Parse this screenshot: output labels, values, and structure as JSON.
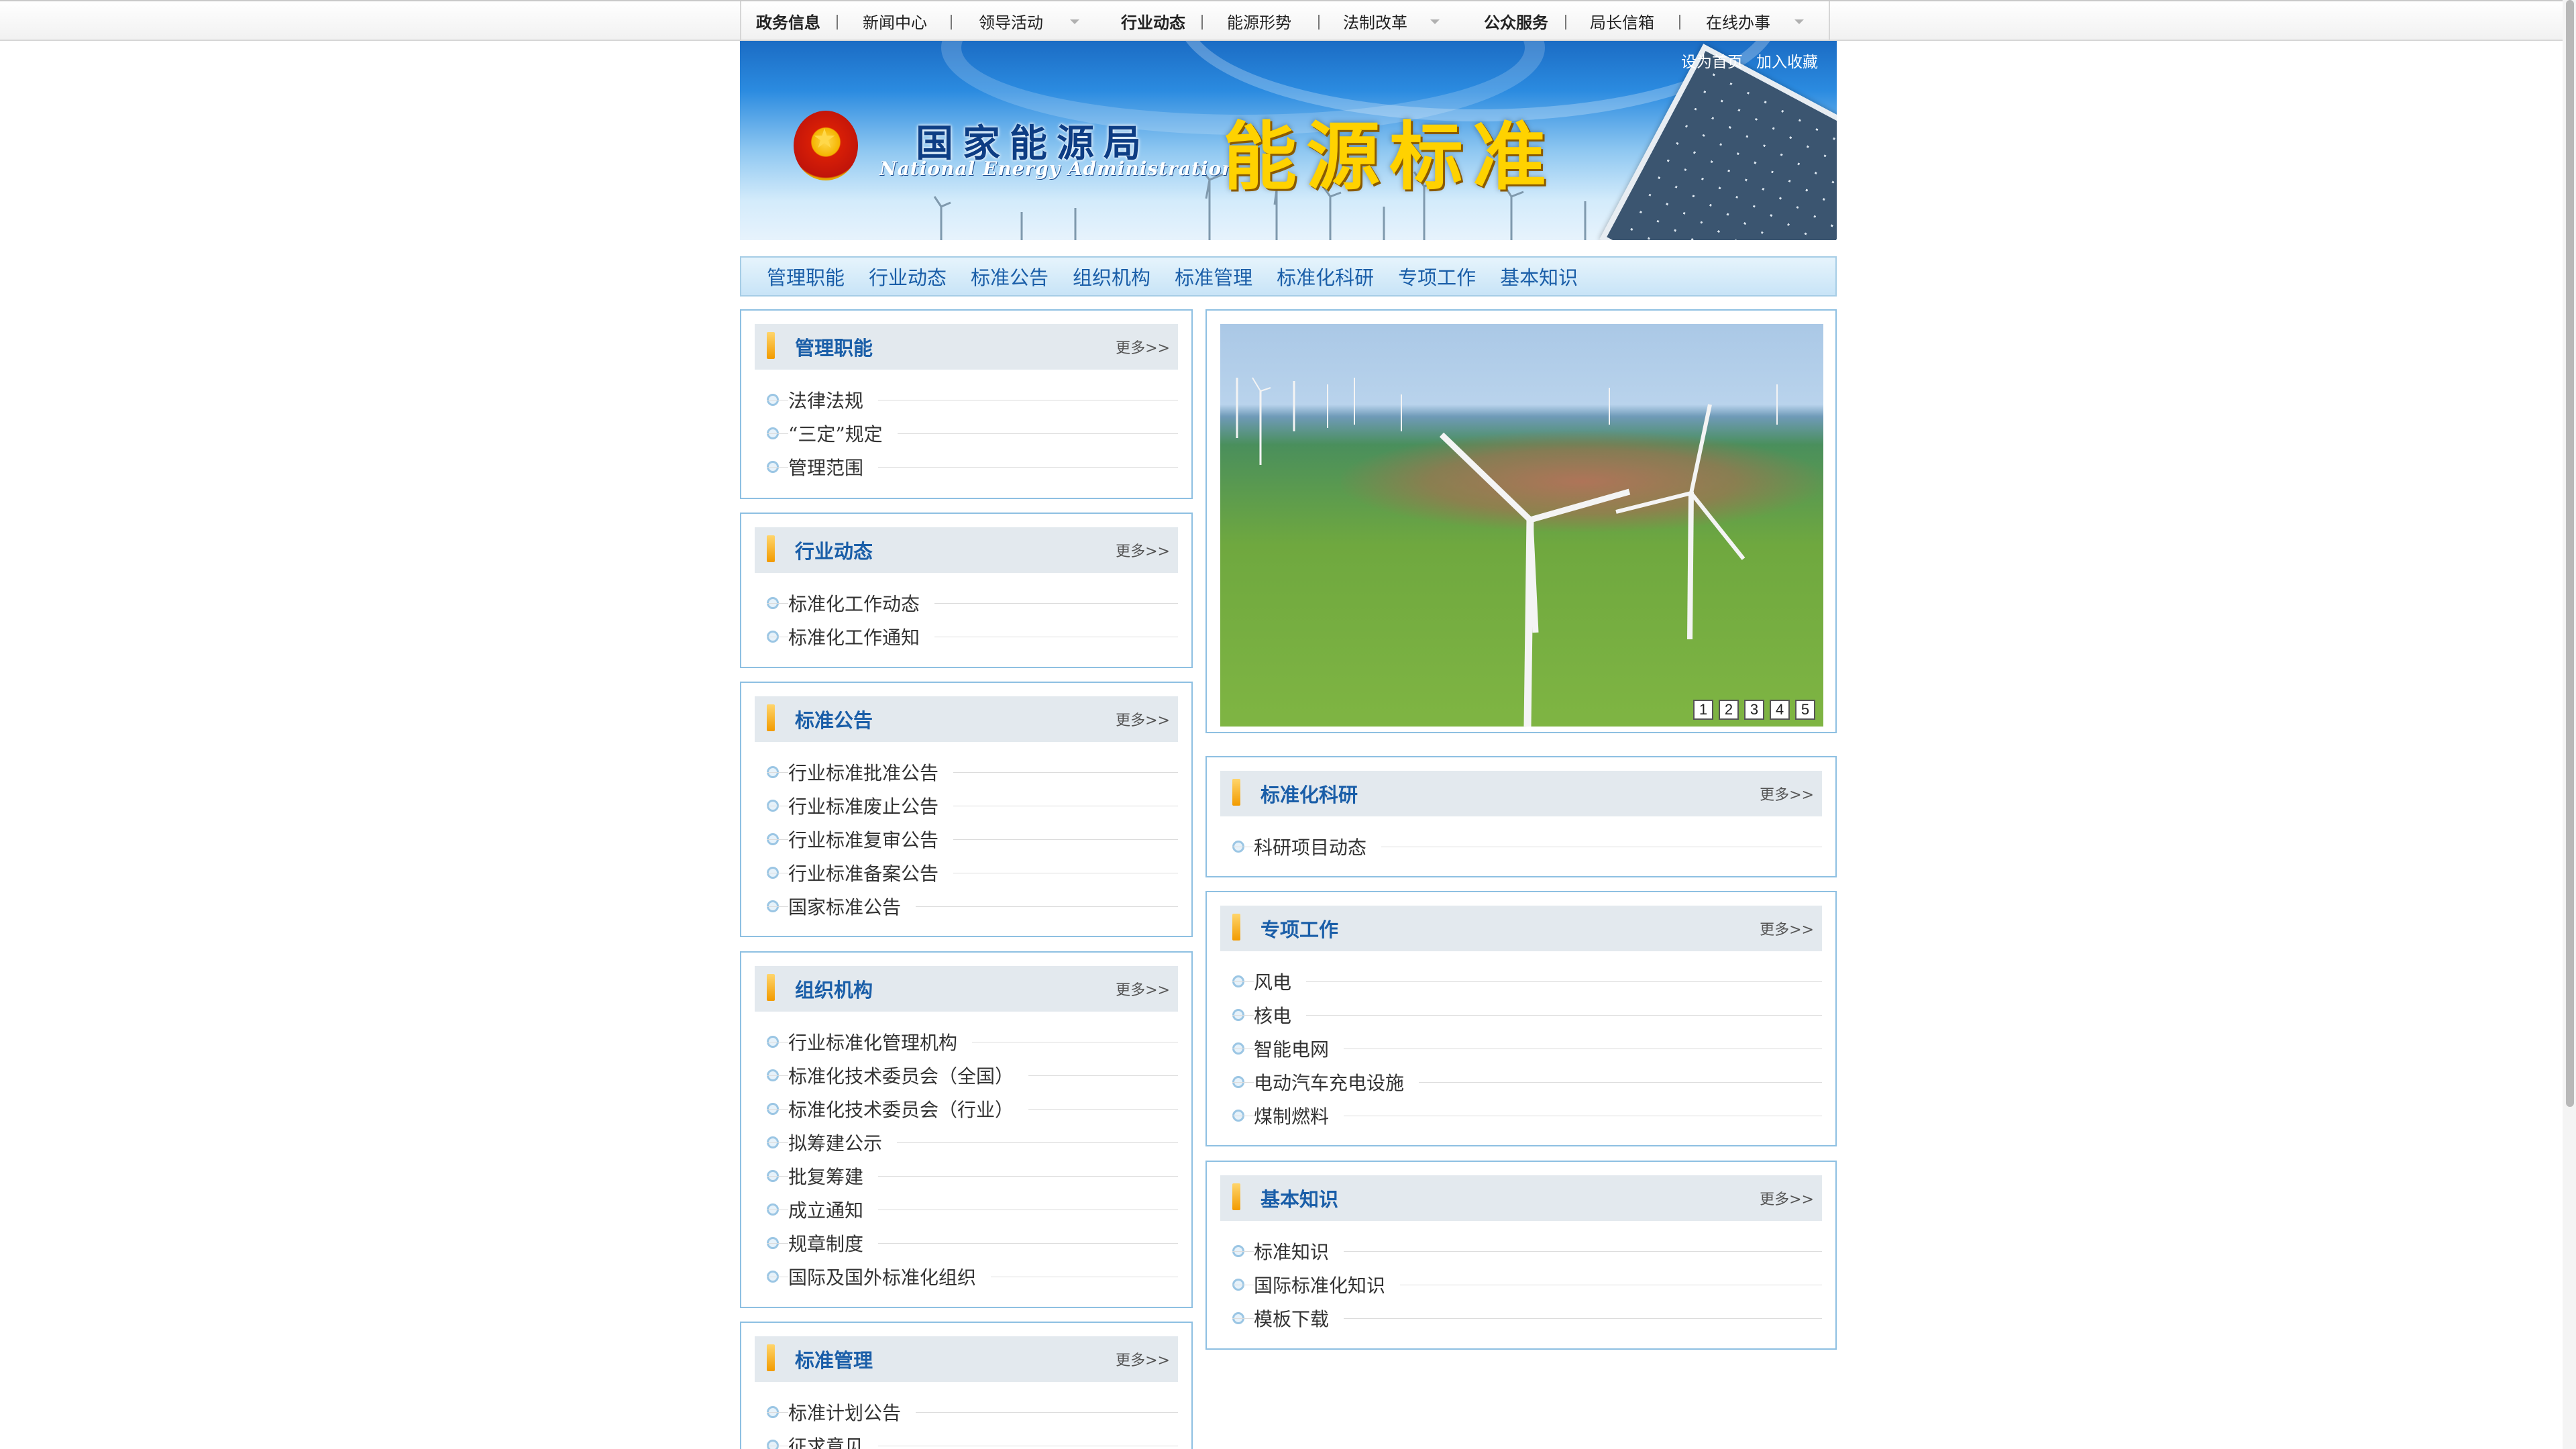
{
  "topnav": {
    "items": [
      {
        "label": "政务信息"
      },
      {
        "label": "新闻中心"
      },
      {
        "label": "领导活动"
      },
      {
        "label": "行业动态"
      },
      {
        "label": "能源形势"
      },
      {
        "label": "法制改革"
      },
      {
        "label": "公众服务"
      },
      {
        "label": "局长信箱"
      },
      {
        "label": "在线办事"
      }
    ]
  },
  "banner": {
    "set_home": "设为首页",
    "add_favorite": "加入收藏",
    "org_name_cn": "国家能源局",
    "org_name_en": "National Energy Administration",
    "site_title": "能源标准"
  },
  "subnav": {
    "items": [
      "管理职能",
      "行业动态",
      "标准公告",
      "组织机构",
      "标准管理",
      "标准化科研",
      "专项工作",
      "基本知识"
    ]
  },
  "more_label": "更多>>",
  "sections": {
    "mgmt": {
      "title": "管理职能",
      "items": [
        "法律法规",
        "“三定”规定",
        "管理范围"
      ]
    },
    "industry": {
      "title": "行业动态",
      "items": [
        "标准化工作动态",
        "标准化工作通知"
      ]
    },
    "notice": {
      "title": "标准公告",
      "items": [
        "行业标准批准公告",
        "行业标准废止公告",
        "行业标准复审公告",
        "行业标准备案公告",
        "国家标准公告"
      ]
    },
    "org": {
      "title": "组织机构",
      "items": [
        "行业标准化管理机构",
        "标准化技术委员会（全国）",
        "标准化技术委员会（行业）",
        "拟筹建公示",
        "批复筹建",
        "成立通知",
        "规章制度",
        "国际及国外标准化组织"
      ]
    },
    "stdmgmt": {
      "title": "标准管理",
      "items": [
        "标准计划公告",
        "征求意见"
      ]
    },
    "research": {
      "title": "标准化科研",
      "items": [
        "科研项目动态"
      ]
    },
    "special": {
      "title": "专项工作",
      "items": [
        "风电",
        "核电",
        "智能电网",
        "电动汽车充电设施",
        "煤制燃料"
      ]
    },
    "basics": {
      "title": "基本知识",
      "items": [
        "标准知识",
        "国际标准化知识",
        "模板下载"
      ]
    }
  },
  "slideshow": {
    "pages": [
      "1",
      "2",
      "3",
      "4",
      "5"
    ]
  }
}
